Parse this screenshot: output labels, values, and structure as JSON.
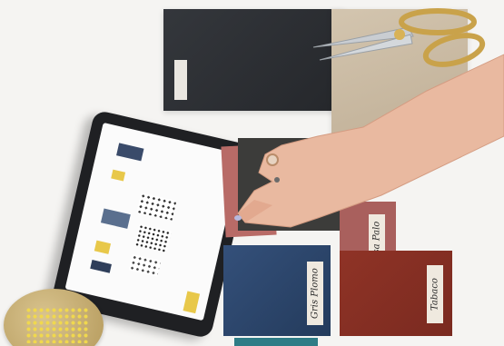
{
  "photo": {
    "swatch_labels": {
      "gris_plomo": "Gris Plomo",
      "rosa_palo": "Rosa Palo",
      "tabaco": "Tabaco"
    },
    "colors": {
      "background": "#f5f4f2",
      "dark_fabric": "#2f3135",
      "beige_fabric": "#cbbca6",
      "scissor_gold": "#c9a24a",
      "scissor_silver": "#c7cbcf",
      "rose_swatch": "#b86b67",
      "navy_swatch": "#2f4a6e",
      "rust_swatch": "#8a2f24",
      "tablet_frame": "#2a2b2e",
      "pin_tray": "#c7b07c",
      "pins": "#e6d14a"
    }
  }
}
